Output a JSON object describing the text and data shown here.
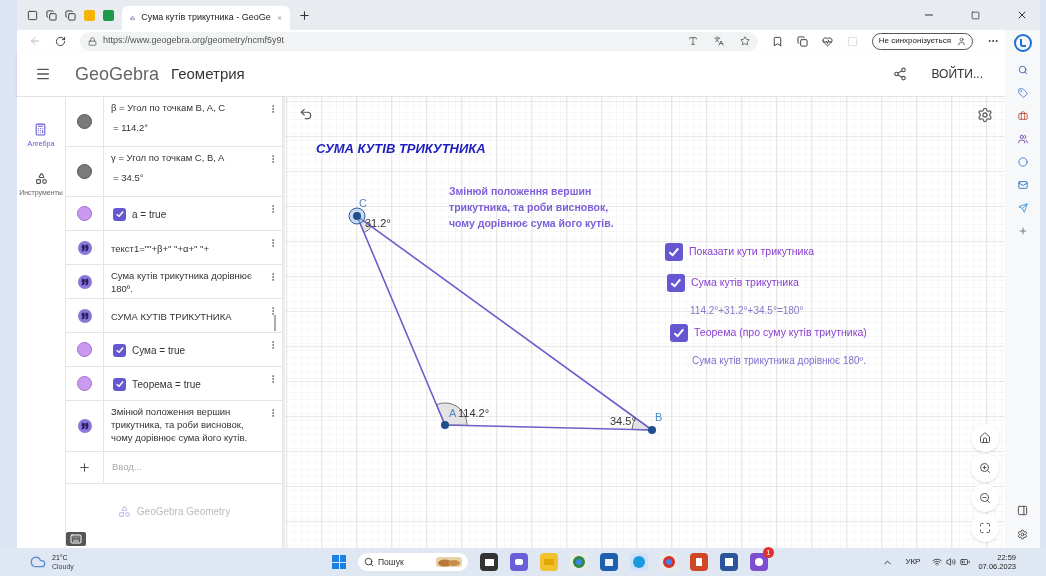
{
  "browser": {
    "tabs": [
      {
        "title": "Сума кутів трикутника - GeoGe",
        "selected": true
      }
    ],
    "url": "https://www.geogebra.org/geometry/ncmf5y9t",
    "sync_button": "Не синхронізується"
  },
  "app": {
    "brand": "GeoGebra",
    "app_name": "Геометрия",
    "login": "ВОЙТИ..."
  },
  "nav": [
    {
      "label": "Алгебра",
      "selected": true
    },
    {
      "label": "Инструменты",
      "selected": false
    }
  ],
  "algebra": {
    "items": [
      {
        "kind": "angle",
        "text": "β = Угол по точкам B, A, C",
        "value": "= 114.2°"
      },
      {
        "kind": "angle",
        "text": "γ = Угол по точкам C, B, A",
        "value": "= 34.5°"
      },
      {
        "kind": "bool",
        "text": "a = true",
        "checked": true
      },
      {
        "kind": "text",
        "text": "текст1=\"\"+β+\" \"+α+\" \"+"
      },
      {
        "kind": "text",
        "text": "Сума кутів трикутника дорівнює 180º."
      },
      {
        "kind": "text",
        "text": "СУМА КУТІВ ТРИКУТНИКА"
      },
      {
        "kind": "bool",
        "text": "Сума = true",
        "checked": true
      },
      {
        "kind": "bool",
        "text": "Теорема = true",
        "checked": true
      },
      {
        "kind": "text",
        "text": "Змінюй положення вершин трикутника, та роби висновок, чому дорівнює сума його кутів."
      }
    ],
    "input_placeholder": "Ввод...",
    "footer": "GeoGebra Geometry"
  },
  "canvas": {
    "title": "СУМА КУТІВ ТРИКУТНИКА",
    "instruction": "Змінюй положення вершин трикутника, та роби висновок, чому дорівнює сума його кутів.",
    "points": [
      {
        "label": "C"
      },
      {
        "label": "A"
      },
      {
        "label": "B"
      }
    ],
    "angles": [
      "31.2°",
      "114.2°",
      "34.5°"
    ],
    "checkboxes": [
      {
        "label": "Показати кути трикутника",
        "checked": true
      },
      {
        "label": "Сума кутів трикутника",
        "checked": true
      },
      {
        "label": "Теорема (про суму кутів триутника)",
        "checked": true
      }
    ],
    "sum_text": "114.2°+31.2°+34.5°=180°",
    "theorem_text": "Сума кутів трикутника дорівнює 180º."
  },
  "taskbar": {
    "temperature": "21°C",
    "weather": "Cloudy",
    "search": "Пошук",
    "badge": "1",
    "language": "УКР",
    "time": "22:59",
    "date": "07.06.2023"
  }
}
